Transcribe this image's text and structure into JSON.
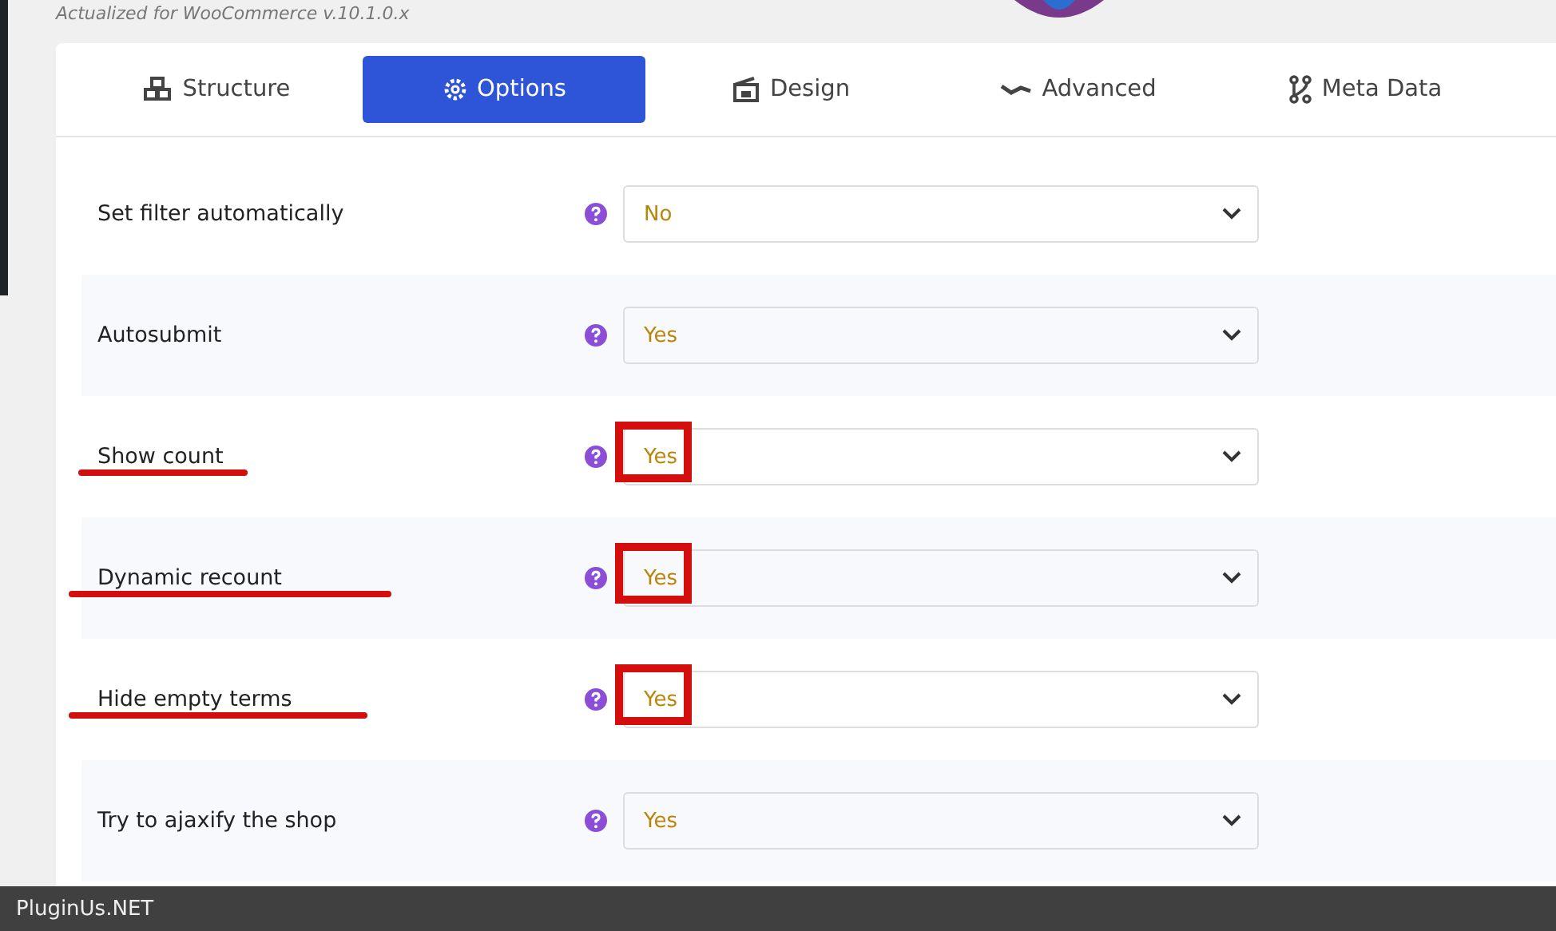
{
  "header": {
    "subtitle": "Actualized for WooCommerce v.10.1.0.x"
  },
  "tabs": [
    {
      "label": "Structure",
      "kind": "cubes",
      "selected": false
    },
    {
      "label": "Options",
      "kind": "gear",
      "selected": true
    },
    {
      "label": "Design",
      "kind": "design",
      "selected": false
    },
    {
      "label": "Advanced",
      "kind": "wave",
      "selected": false
    },
    {
      "label": "Meta Data",
      "kind": "nodes",
      "selected": false
    }
  ],
  "options": [
    {
      "label": "Set filter automatically",
      "value": "No",
      "highlighted": false,
      "underlined": false
    },
    {
      "label": "Autosubmit",
      "value": "Yes",
      "highlighted": false,
      "underlined": false
    },
    {
      "label": "Show count",
      "value": "Yes",
      "highlighted": true,
      "underlined": true
    },
    {
      "label": "Dynamic recount",
      "value": "Yes",
      "highlighted": true,
      "underlined": true
    },
    {
      "label": "Hide empty terms",
      "value": "Yes",
      "highlighted": true,
      "underlined": true
    },
    {
      "label": "Try to ajaxify the shop",
      "value": "Yes",
      "highlighted": false,
      "underlined": false
    }
  ],
  "footer": {
    "text": "PluginUs.NET"
  }
}
